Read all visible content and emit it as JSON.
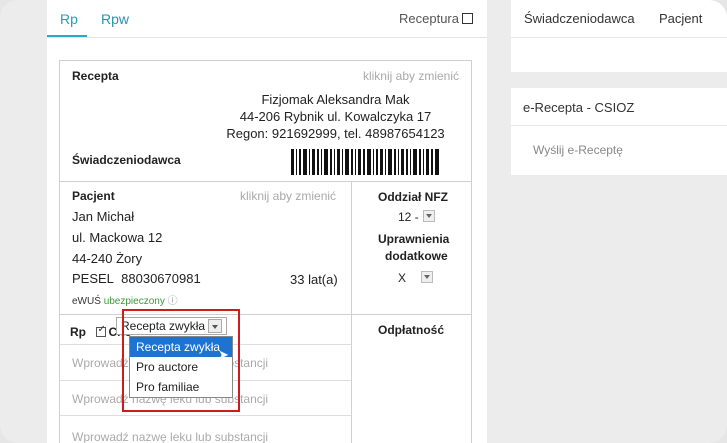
{
  "tabs": {
    "rp": "Rp",
    "rpw": "Rpw",
    "receptura": "Receptura"
  },
  "recepta": {
    "title": "Recepta",
    "hint": "kliknij aby zmienić",
    "doctor_name": "Fizjomak Aleksandra Mak",
    "address": "44-206 Rybnik ul. Kowalczyka 17",
    "regon_line": "Regon: 921692999, tel. 48987654123",
    "provider_label": "Świadczeniodawca"
  },
  "patient": {
    "title": "Pacjent",
    "hint": "kliknij aby zmienić",
    "name": "Jan Michał",
    "street": "ul. Mackowa 12",
    "city": "44-240 Żory",
    "pesel_label": "PESEL",
    "pesel": "88030670981",
    "age": "33 lat(a)",
    "ewus_label": "eWUŚ",
    "ewus_status": "ubezpieczony"
  },
  "nfz": {
    "title": "Oddział NFZ",
    "value": "12 -",
    "rights_title_1": "Uprawnienia",
    "rights_title_2": "dodatkowe",
    "rights_value": "X"
  },
  "rp_section": {
    "rp_label": "Rp",
    "cito_label": "Cito",
    "selected_type": "Recepta zwykła",
    "payment_label": "Odpłatność",
    "drug_placeholder": "Wprowadź nazwę leku lub substancji",
    "options": [
      "Recepta zwykła",
      "Pro auctore",
      "Pro familiae"
    ]
  },
  "right": {
    "provider_tab": "Świadczeniodawca",
    "patient_tab": "Pacjent",
    "erecepta_title": "e-Recepta - CSIOZ",
    "send_button": "Wyślij e-Receptę"
  }
}
